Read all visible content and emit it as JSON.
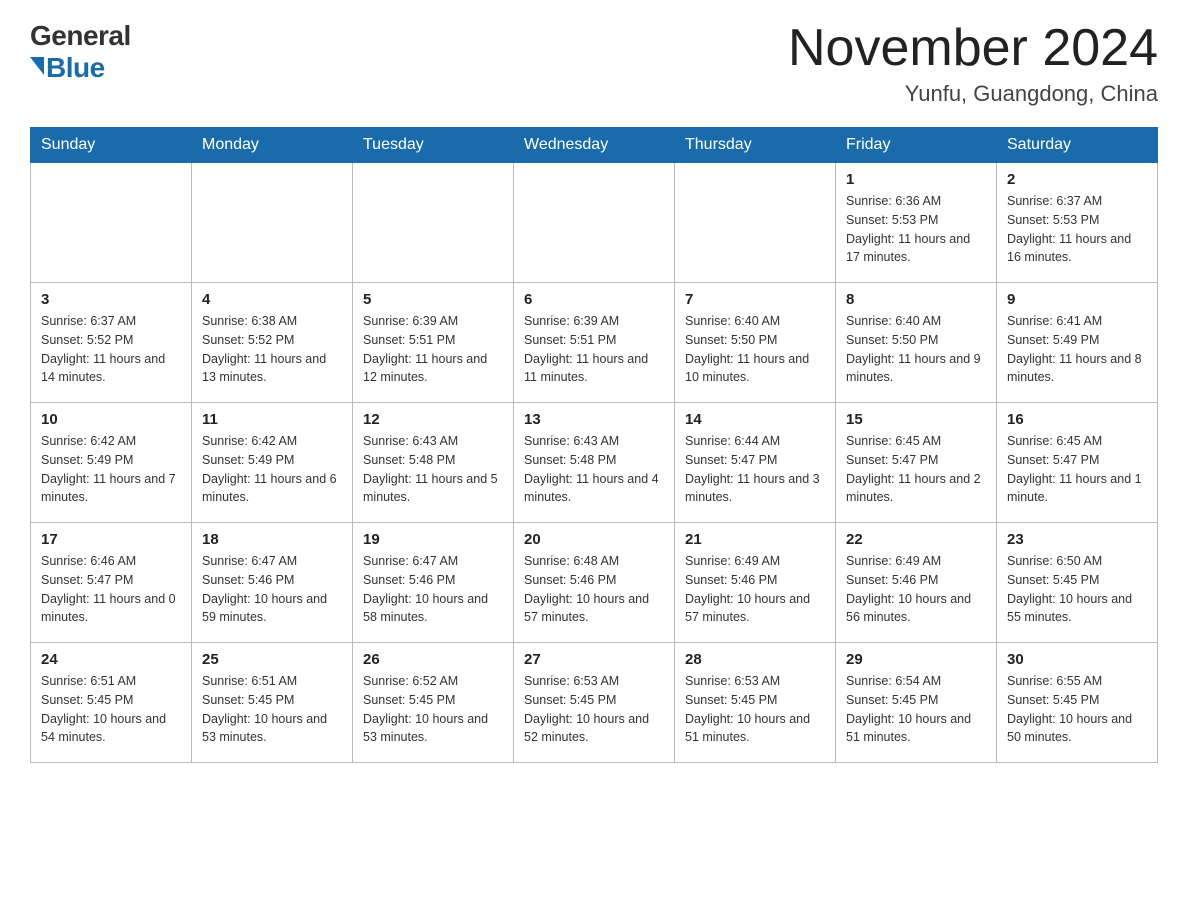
{
  "header": {
    "logo_general": "General",
    "logo_blue": "Blue",
    "month_title": "November 2024",
    "location": "Yunfu, Guangdong, China"
  },
  "weekdays": [
    "Sunday",
    "Monday",
    "Tuesday",
    "Wednesday",
    "Thursday",
    "Friday",
    "Saturday"
  ],
  "weeks": [
    [
      {
        "day": "",
        "info": ""
      },
      {
        "day": "",
        "info": ""
      },
      {
        "day": "",
        "info": ""
      },
      {
        "day": "",
        "info": ""
      },
      {
        "day": "",
        "info": ""
      },
      {
        "day": "1",
        "info": "Sunrise: 6:36 AM\nSunset: 5:53 PM\nDaylight: 11 hours\nand 17 minutes."
      },
      {
        "day": "2",
        "info": "Sunrise: 6:37 AM\nSunset: 5:53 PM\nDaylight: 11 hours\nand 16 minutes."
      }
    ],
    [
      {
        "day": "3",
        "info": "Sunrise: 6:37 AM\nSunset: 5:52 PM\nDaylight: 11 hours\nand 14 minutes."
      },
      {
        "day": "4",
        "info": "Sunrise: 6:38 AM\nSunset: 5:52 PM\nDaylight: 11 hours\nand 13 minutes."
      },
      {
        "day": "5",
        "info": "Sunrise: 6:39 AM\nSunset: 5:51 PM\nDaylight: 11 hours\nand 12 minutes."
      },
      {
        "day": "6",
        "info": "Sunrise: 6:39 AM\nSunset: 5:51 PM\nDaylight: 11 hours\nand 11 minutes."
      },
      {
        "day": "7",
        "info": "Sunrise: 6:40 AM\nSunset: 5:50 PM\nDaylight: 11 hours\nand 10 minutes."
      },
      {
        "day": "8",
        "info": "Sunrise: 6:40 AM\nSunset: 5:50 PM\nDaylight: 11 hours\nand 9 minutes."
      },
      {
        "day": "9",
        "info": "Sunrise: 6:41 AM\nSunset: 5:49 PM\nDaylight: 11 hours\nand 8 minutes."
      }
    ],
    [
      {
        "day": "10",
        "info": "Sunrise: 6:42 AM\nSunset: 5:49 PM\nDaylight: 11 hours\nand 7 minutes."
      },
      {
        "day": "11",
        "info": "Sunrise: 6:42 AM\nSunset: 5:49 PM\nDaylight: 11 hours\nand 6 minutes."
      },
      {
        "day": "12",
        "info": "Sunrise: 6:43 AM\nSunset: 5:48 PM\nDaylight: 11 hours\nand 5 minutes."
      },
      {
        "day": "13",
        "info": "Sunrise: 6:43 AM\nSunset: 5:48 PM\nDaylight: 11 hours\nand 4 minutes."
      },
      {
        "day": "14",
        "info": "Sunrise: 6:44 AM\nSunset: 5:47 PM\nDaylight: 11 hours\nand 3 minutes."
      },
      {
        "day": "15",
        "info": "Sunrise: 6:45 AM\nSunset: 5:47 PM\nDaylight: 11 hours\nand 2 minutes."
      },
      {
        "day": "16",
        "info": "Sunrise: 6:45 AM\nSunset: 5:47 PM\nDaylight: 11 hours\nand 1 minute."
      }
    ],
    [
      {
        "day": "17",
        "info": "Sunrise: 6:46 AM\nSunset: 5:47 PM\nDaylight: 11 hours\nand 0 minutes."
      },
      {
        "day": "18",
        "info": "Sunrise: 6:47 AM\nSunset: 5:46 PM\nDaylight: 10 hours\nand 59 minutes."
      },
      {
        "day": "19",
        "info": "Sunrise: 6:47 AM\nSunset: 5:46 PM\nDaylight: 10 hours\nand 58 minutes."
      },
      {
        "day": "20",
        "info": "Sunrise: 6:48 AM\nSunset: 5:46 PM\nDaylight: 10 hours\nand 57 minutes."
      },
      {
        "day": "21",
        "info": "Sunrise: 6:49 AM\nSunset: 5:46 PM\nDaylight: 10 hours\nand 57 minutes."
      },
      {
        "day": "22",
        "info": "Sunrise: 6:49 AM\nSunset: 5:46 PM\nDaylight: 10 hours\nand 56 minutes."
      },
      {
        "day": "23",
        "info": "Sunrise: 6:50 AM\nSunset: 5:45 PM\nDaylight: 10 hours\nand 55 minutes."
      }
    ],
    [
      {
        "day": "24",
        "info": "Sunrise: 6:51 AM\nSunset: 5:45 PM\nDaylight: 10 hours\nand 54 minutes."
      },
      {
        "day": "25",
        "info": "Sunrise: 6:51 AM\nSunset: 5:45 PM\nDaylight: 10 hours\nand 53 minutes."
      },
      {
        "day": "26",
        "info": "Sunrise: 6:52 AM\nSunset: 5:45 PM\nDaylight: 10 hours\nand 53 minutes."
      },
      {
        "day": "27",
        "info": "Sunrise: 6:53 AM\nSunset: 5:45 PM\nDaylight: 10 hours\nand 52 minutes."
      },
      {
        "day": "28",
        "info": "Sunrise: 6:53 AM\nSunset: 5:45 PM\nDaylight: 10 hours\nand 51 minutes."
      },
      {
        "day": "29",
        "info": "Sunrise: 6:54 AM\nSunset: 5:45 PM\nDaylight: 10 hours\nand 51 minutes."
      },
      {
        "day": "30",
        "info": "Sunrise: 6:55 AM\nSunset: 5:45 PM\nDaylight: 10 hours\nand 50 minutes."
      }
    ]
  ]
}
